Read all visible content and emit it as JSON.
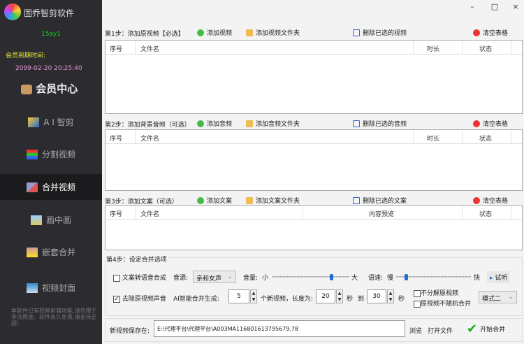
{
  "app": {
    "title": "固乔智剪软件",
    "username": "15ay1",
    "expiry_label": "会员到期时间:",
    "expiry_value": "2099-02-20 20:25:40",
    "vip_center": "会员中心"
  },
  "window": {
    "minimize": "–",
    "maximize": "□",
    "close": "×"
  },
  "sidebar": {
    "items": [
      {
        "label": "A I 智剪",
        "icon": "ai-wand-icon"
      },
      {
        "label": "分割视频",
        "icon": "split-icon"
      },
      {
        "label": "合并视频",
        "icon": "merge-icon",
        "active": true
      },
      {
        "label": "画中画",
        "icon": "picture-in-picture-icon"
      },
      {
        "label": "嵌套合并",
        "icon": "nest-icon"
      },
      {
        "label": "视频封面",
        "icon": "cover-icon"
      }
    ],
    "notice": "本软件已有视频剪辑功能,请勿用于非法用途。软件永久免费,请支持正版!"
  },
  "step1": {
    "title": "第1步：添加原视频【必选】",
    "add": "添加视频",
    "add_folder": "添加视频文件夹",
    "delete": "删除已选的视频",
    "clear": "清空表格",
    "columns": [
      "序号",
      "文件名",
      "时长",
      "状态"
    ]
  },
  "step2": {
    "title": "第2步：添加背景音频（可选）",
    "add": "添加音频",
    "add_folder": "添加音频文件夹",
    "delete": "删除已选的音频",
    "clear": "清空表格",
    "columns": [
      "序号",
      "文件名",
      "时长",
      "状态"
    ]
  },
  "step3": {
    "title": "第3步：添加文案（可选）",
    "add": "添加文案",
    "add_folder": "添加文案文件夹",
    "delete": "删除已选的文案",
    "clear": "清空表格",
    "columns": [
      "序号",
      "文件名",
      "内容预览",
      "状态"
    ]
  },
  "step4": {
    "title": "第4步：设定合并选项",
    "tts_label": "文案转语音合成",
    "voice_label": "音源:",
    "voice_value": "亲和女声",
    "volume_label": "音量:",
    "volume_min": "小",
    "volume_max": "大",
    "volume_level": 0.78,
    "speed_label": "语速:",
    "speed_min": "慢",
    "speed_max": "快",
    "speed_level": 0.12,
    "listen": "试听",
    "tts_checked": false,
    "remove_audio_label": "去除原视频声音",
    "remove_audio_checked": true,
    "ai_label": "AI智能合并生成:",
    "count": "5",
    "count_unit": "个新视频，长度为:",
    "len_min": "20",
    "sec": "秒",
    "to": "到",
    "len_max": "30",
    "sec2": "秒",
    "no_split": "不分解原视频",
    "no_split_checked": false,
    "no_random": "原视频不随机合并",
    "no_random_checked": false,
    "mode": "模式二"
  },
  "output": {
    "label": "新视频保存在:",
    "path": "E:\\代理平台\\代理平台\\A003MA116801613795679.78",
    "browse": "浏览",
    "open": "打开文件",
    "start": "开始合并"
  }
}
